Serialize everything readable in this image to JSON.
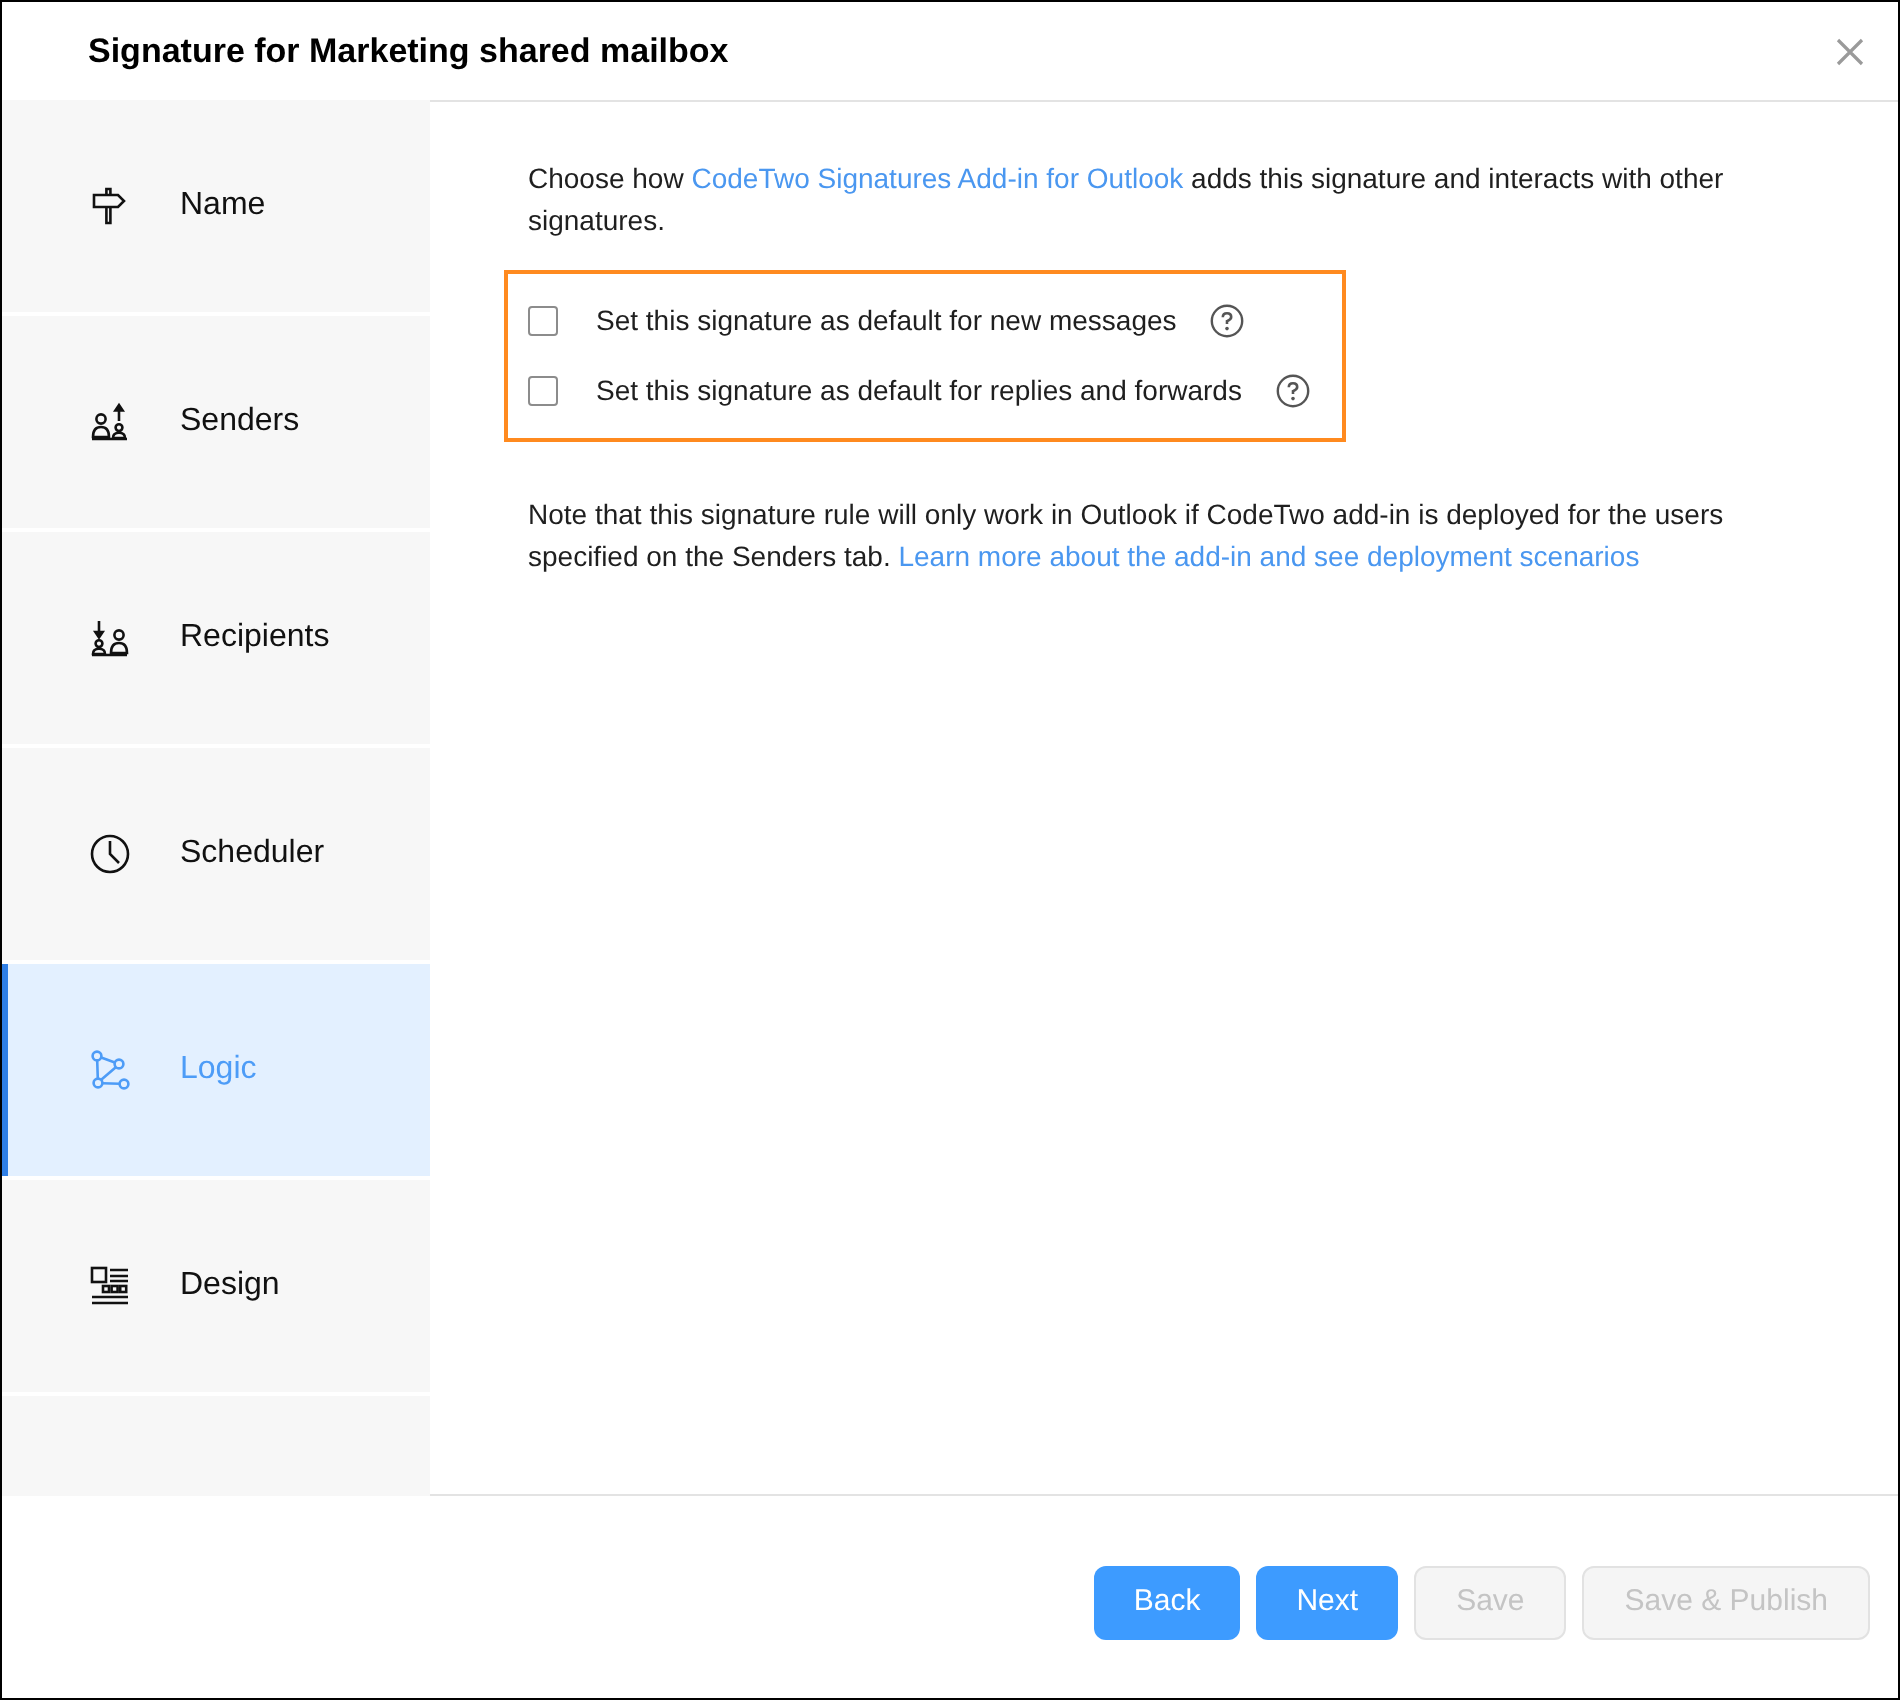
{
  "window": {
    "title": "Signature for Marketing shared mailbox"
  },
  "sidebar": {
    "items": [
      {
        "label": "Name",
        "selected": false
      },
      {
        "label": "Senders",
        "selected": false
      },
      {
        "label": "Recipients",
        "selected": false
      },
      {
        "label": "Scheduler",
        "selected": false
      },
      {
        "label": "Logic",
        "selected": true
      },
      {
        "label": "Design",
        "selected": false
      }
    ]
  },
  "content": {
    "intro": {
      "text_before": "Choose how",
      "link": "CodeTwo Signatures Add-in for Outlook",
      "text_after": "adds this signature and interacts with other signatures."
    },
    "option_group": {
      "highlighted": true,
      "options": [
        {
          "label": "Set this signature as default for new messages",
          "checked": false
        },
        {
          "label": "Set this signature as default for replies and forwards",
          "checked": false
        }
      ]
    },
    "note": {
      "text": "Note that this signature rule will only work in Outlook if CodeTwo add-in is deployed for the users specified on the Senders tab.",
      "link": "Learn more about the add-in and see deployment scenarios"
    }
  },
  "footer": {
    "buttons": [
      {
        "label": "Back",
        "disabled": false
      },
      {
        "label": "Next",
        "disabled": false
      },
      {
        "label": "Save",
        "disabled": true
      },
      {
        "label": "Save & Publish",
        "disabled": true
      }
    ]
  }
}
